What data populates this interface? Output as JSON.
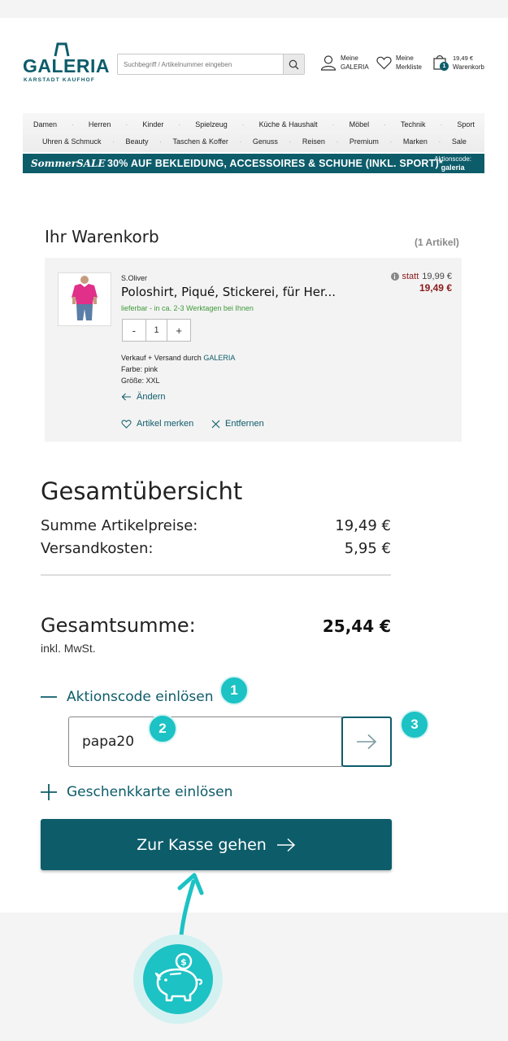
{
  "header": {
    "logo": {
      "name": "GALERIA",
      "sub": "KARSTADT KAUFHOF"
    },
    "search_placeholder": "Suchbegriff / Artikelnummer eingeben",
    "account": {
      "line1": "Meine",
      "line2": "GALERIA"
    },
    "wishlist": {
      "line1": "Meine",
      "line2": "Merkliste"
    },
    "cart": {
      "amount": "19,49 €",
      "label": "Warenkorb",
      "count": "1"
    }
  },
  "nav": {
    "row1": [
      "Damen",
      "Herren",
      "Kinder",
      "Spielzeug",
      "Küche & Haushalt",
      "Möbel",
      "Technik",
      "Sport"
    ],
    "row2": [
      "Uhren & Schmuck",
      "Beauty",
      "Taschen & Koffer",
      "Genuss",
      "Reisen",
      "Premium",
      "Marken",
      "Sale"
    ]
  },
  "banner": {
    "label": "SommerSALE",
    "text": "30% AUF BEKLEIDUNG, ACCESSOIRES & SCHUHE (INKL. SPORT)*",
    "code_label": "Aktionscode:",
    "code": "galeria"
  },
  "cart": {
    "title": "Ihr Warenkorb",
    "count_label": "(1 Artikel)",
    "item": {
      "brand": "S.Oliver",
      "name": "Poloshirt, Piqué, Stickerei, für Her...",
      "delivery": "lieferbar - in ca. 2-3 Werktagen bei Ihnen",
      "quantity": "1",
      "minus": "-",
      "plus": "+",
      "seller_prefix": "Verkauf + Versand durch ",
      "seller": "GALERIA",
      "color": "Farbe: pink",
      "size": "Größe: XXL",
      "change": "Ändern",
      "save": "Artikel merken",
      "remove": "Entfernen",
      "price_prefix": "statt",
      "price_old": "19,99 €",
      "price_new": "19,49 €"
    }
  },
  "summary": {
    "title": "Gesamtübersicht",
    "items_label": "Summe Artikelpreise:",
    "items_value": "19,49 €",
    "shipping_label": "Versandkosten:",
    "shipping_value": "5,95 €",
    "total_label": "Gesamtsumme:",
    "total_value": "25,44 €",
    "vat_note": "inkl. MwSt."
  },
  "promo": {
    "toggle_label": "Aktionscode einlösen",
    "code_value": "papa20"
  },
  "giftcard": {
    "toggle_label": "Geschenkkarte einlösen"
  },
  "checkout": {
    "label": "Zur Kasse gehen"
  },
  "badges": [
    "1",
    "2",
    "3"
  ],
  "colors": {
    "brand": "#0d5c6a",
    "accent": "#1cc2c4",
    "price": "#8b1a1a",
    "delivery": "#3f9a3a"
  }
}
